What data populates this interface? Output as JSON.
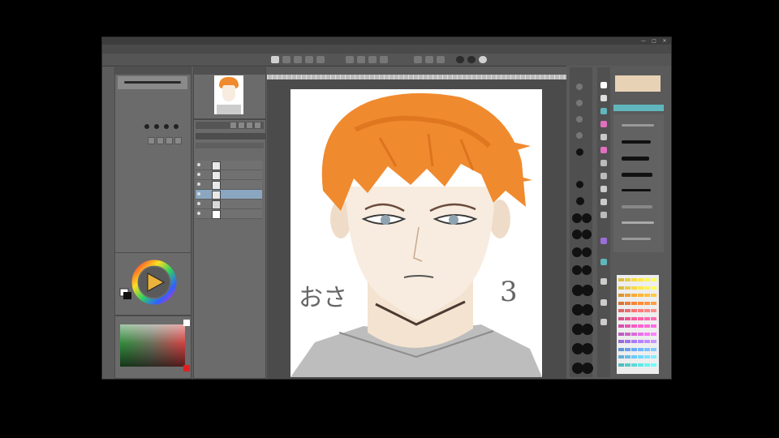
{
  "window": {
    "title": "",
    "controls": [
      "—",
      "□",
      "✕"
    ]
  },
  "menu": {
    "items": [
      "",
      "",
      "",
      "",
      "",
      "",
      "",
      "",
      "",
      "",
      "",
      ""
    ]
  },
  "tool_property": {
    "title": "",
    "rows": [
      "",
      "",
      "",
      "",
      "",
      "",
      ""
    ]
  },
  "navigator": {
    "title": ""
  },
  "layers": {
    "blend_mode": "",
    "items": [
      {
        "name": "",
        "selected": false
      },
      {
        "name": "",
        "selected": false
      },
      {
        "name": "",
        "selected": false
      },
      {
        "name": "",
        "selected": true
      },
      {
        "name": "",
        "selected": false
      },
      {
        "name": "",
        "selected": false
      }
    ]
  },
  "artwork": {
    "handwriting_left": "おさ",
    "handwriting_right": "3"
  },
  "colors": {
    "hair": "#f08a2e",
    "hair_shadow": "#d46a17",
    "skin": "#f7ecdf",
    "eye": "#8fa3b0",
    "ui_panel": "#6b6b6b",
    "selection": "#8aa6c0",
    "cyan_button": "#5fb7bd"
  },
  "icons": [
    "color-wheel-icon",
    "play-triangle-icon",
    "eye-icon",
    "brush-stroke-icon",
    "palette-icon"
  ]
}
